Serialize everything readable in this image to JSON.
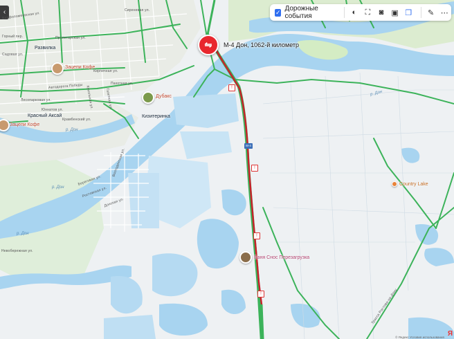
{
  "toolbar": {
    "traffic_events_label": "Дорожные события",
    "traffic_events_checked": true
  },
  "incident": {
    "title": "М-4 Дон, 1062-й километр"
  },
  "highway_shield": "М-4",
  "places": [
    {
      "name": "Развилка"
    },
    {
      "name": "Красный Аксай"
    },
    {
      "name": "Кизитеринка"
    }
  ],
  "pois": [
    {
      "name": "Зацепи Кофе"
    },
    {
      "name": "Дубакс"
    },
    {
      "name": "Зацепи Кофе"
    },
    {
      "name": "Country Lake"
    },
    {
      "name": "Баня Снос Перезагрузка"
    }
  ],
  "rivers": [
    "р. Дон",
    "р. Дон",
    "р. Дон",
    "р. Дон"
  ],
  "streets": [
    "Варфоломеевская ул.",
    "Горный пер.",
    "Садовая ул.",
    "Пролетарская ул.",
    "Автодорога Победы",
    "Лесопарковая ул.",
    "Юннатов ул.",
    "Береговая ул.",
    "Ростовская ул.",
    "Донская ул.",
    "Невобережная ул.",
    "Волгодонская ул.",
    "Пахотная ул.",
    "Кукольная ул.",
    "Газетная ул.",
    "Кирпичная ул.",
    "Сиреневая ул.",
    "Трасса Ростова-на-Дону",
    "Крамбенский ул."
  ],
  "colors": {
    "water": "#a8d4f0",
    "land": "#eef1f3",
    "green_area": "#d4ecc4",
    "traffic_free": "#3cb35a",
    "traffic_jam": "#c8202a",
    "accent": "#2f6ef0"
  },
  "attribution": "© Яндекс  Условия использования",
  "brand": "Я"
}
